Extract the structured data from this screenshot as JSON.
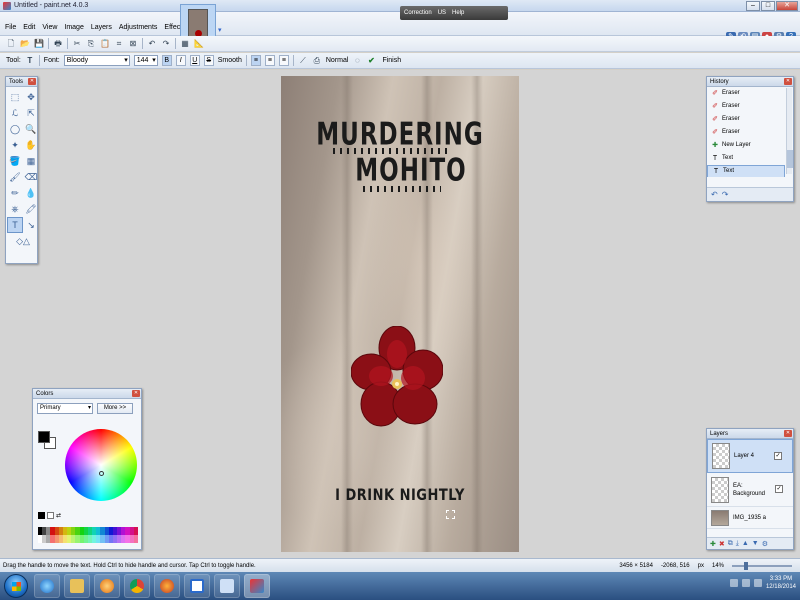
{
  "app": {
    "title": "Untitled - paint.net 4.0.3"
  },
  "menus": [
    "File",
    "Edit",
    "View",
    "Image",
    "Layers",
    "Adjustments",
    "Effects"
  ],
  "help_bar": {
    "items": [
      "Correction",
      "US",
      "Help"
    ]
  },
  "toolbar2": {
    "tool_label": "Tool:",
    "font_label": "Font:",
    "font_value": "Bloody",
    "size_value": "144",
    "bold": "B",
    "italic": "I",
    "underline": "U",
    "strike": "S",
    "antialias_label": "Smooth",
    "blend_label": "Normal",
    "finish_label": "Finish"
  },
  "canvas": {
    "headline_line1": "MURDERING",
    "headline_line2": "MOHITO",
    "tagline": "I DRINK NIGHTLY"
  },
  "tools_panel": {
    "title": "Tools"
  },
  "history_panel": {
    "title": "History",
    "items": [
      "Eraser",
      "Eraser",
      "Eraser",
      "Eraser",
      "New Layer",
      "Text",
      "Text"
    ],
    "selected_index": 6
  },
  "colors_panel": {
    "title": "Colors",
    "mode_value": "Primary",
    "more_label": "More >>",
    "primary_color": "#000000",
    "secondary_color": "#ffffff"
  },
  "layers_panel": {
    "title": "Layers",
    "items": [
      {
        "name": "Layer 4",
        "selected": true
      },
      {
        "name": "EA: Background",
        "selected": false
      },
      {
        "name": "IMG_1935 a",
        "selected": false
      }
    ]
  },
  "statusbar": {
    "message": "Drag the handle to move the text. Hold Ctrl to hide handle and cursor. Tap Ctrl to toggle handle.",
    "image_size": "3456 × 5184",
    "cursor_pos": "-2068, 516",
    "units": "px",
    "zoom": "14%"
  },
  "taskbar": {
    "time": "3:33 PM",
    "date": "12/18/2014"
  },
  "colors": {
    "accent": "#3a6ab0",
    "title_bar": "#c6d7ee",
    "text_ink": "#1b1b1b",
    "flower": "#8b0f16"
  }
}
